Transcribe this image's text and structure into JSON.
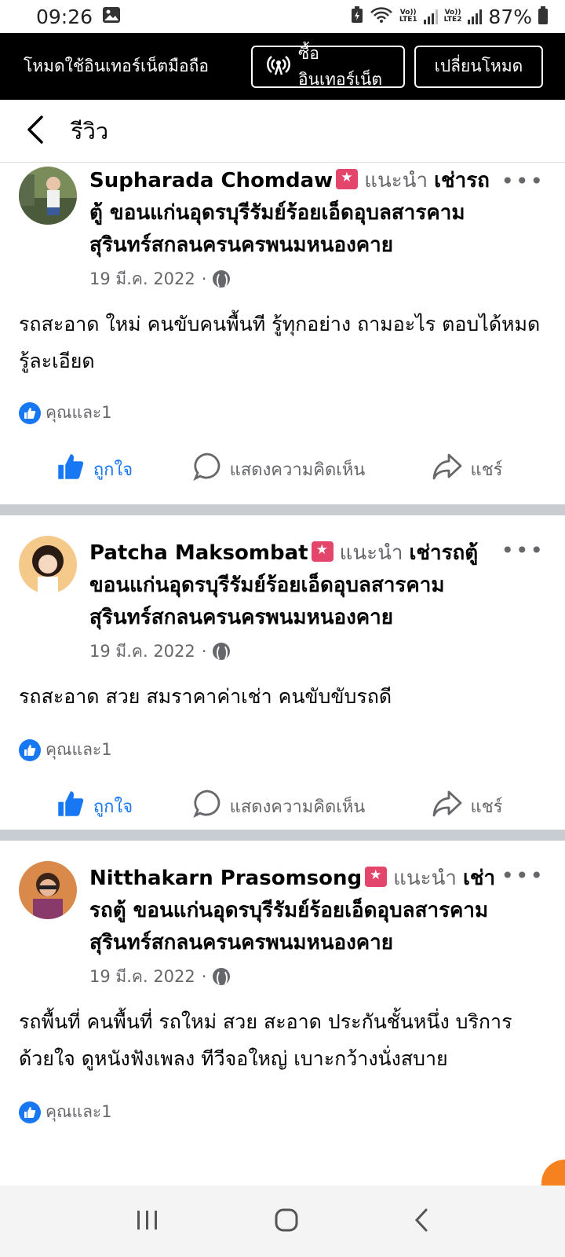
{
  "status_bar": {
    "time": "09:26",
    "battery": "87%",
    "sim1": "LTE1",
    "sim2": "LTE2",
    "volte": "Vo))"
  },
  "mode_banner": {
    "text": "โหมดใช้อินเทอร์เน็ตมือถือ",
    "buy_label": "ซื้ออินเทอร์เน็ต",
    "switch_label": "เปลี่ยนโหมด"
  },
  "header": {
    "title": "รีวิว"
  },
  "posts": [
    {
      "author": "Supharada Chomdaw",
      "recommend": "แนะนำ",
      "page": "เช่ารถตู้ ขอนแก่นอุดรบุรีรัมย์ร้อยเอ็ดอุบลสารคามสุรินทร์สกลนครนครพนมหนองคาย",
      "date": "19 มี.ค. 2022",
      "dot": "·",
      "text": "รถสะอาด ใหม่ คนขับคนพื้นที รู้ทุกอย่าง ถามอะไร ตอบได้หมด รู้ละเอียด",
      "reactions": "คุณและ1",
      "like": "ถูกใจ",
      "comment": "แสดงความคิดเห็น",
      "share": "แชร์"
    },
    {
      "author": "Patcha Maksombat",
      "recommend": "แนะนำ",
      "page": "เช่ารถตู้ ขอนแก่นอุดรบุรีรัมย์ร้อยเอ็ดอุบลสารคามสุรินทร์สกลนครนครพนมหนองคาย",
      "date": "19 มี.ค. 2022",
      "dot": "·",
      "text": "รถสะอาด สวย สมราคาค่าเช่า คนขับขับรถดี",
      "reactions": "คุณและ1",
      "like": "ถูกใจ",
      "comment": "แสดงความคิดเห็น",
      "share": "แชร์"
    },
    {
      "author": "Nitthakarn Prasomsong",
      "recommend": "แนะนำ",
      "page": "เช่ารถตู้ ขอนแก่นอุดรบุรีรัมย์ร้อยเอ็ดอุบลสารคามสุรินทร์สกลนครนครพนมหนองคาย",
      "date": "19 มี.ค. 2022",
      "dot": "·",
      "text": "รถพื้นที่ คนพื้นที่ รถใหม่ สวย สะอาด ประกันชั้นหนึ่ง บริการด้วยใจ ดูหนังฟังเพลง ทีวีจอใหญ่ เบาะกว้างนั่งสบาย",
      "reactions": "คุณและ1"
    }
  ],
  "colors": {
    "accent": "#1877f2",
    "secondary_text": "#65676b",
    "divider": "#c9ccd1",
    "badge": "#e4466b",
    "fab": "#f5811f"
  }
}
